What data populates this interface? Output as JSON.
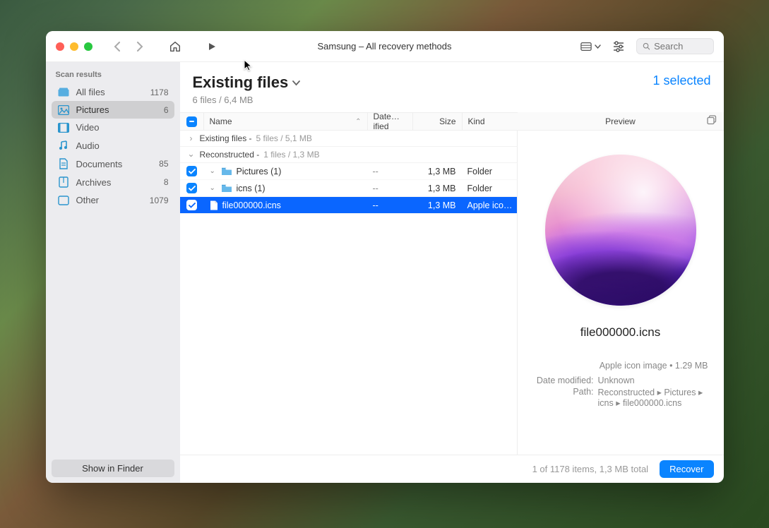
{
  "window_title": "Samsung  – All recovery methods",
  "search": {
    "placeholder": "Search"
  },
  "sidebar": {
    "header": "Scan results",
    "items": [
      {
        "label": "All files",
        "count": "1178"
      },
      {
        "label": "Pictures",
        "count": "6"
      },
      {
        "label": "Video",
        "count": ""
      },
      {
        "label": "Audio",
        "count": ""
      },
      {
        "label": "Documents",
        "count": "85"
      },
      {
        "label": "Archives",
        "count": "8"
      },
      {
        "label": "Other",
        "count": "1079"
      }
    ],
    "show_in_finder": "Show in Finder"
  },
  "content": {
    "title": "Existing files",
    "subtitle": "6 files / 6,4 MB",
    "selected_text": "1 selected",
    "columns": {
      "name": "Name",
      "date": "Date…ified",
      "size": "Size",
      "kind": "Kind"
    },
    "preview_label": "Preview",
    "groups": [
      {
        "label": "Existing files - ",
        "info": "5 files / 5,1 MB",
        "expanded": false
      },
      {
        "label": "Reconstructed - ",
        "info": "1 files / 1,3 MB",
        "expanded": true
      }
    ],
    "rows": [
      {
        "name": "Pictures (1)",
        "date": "--",
        "size": "1,3 MB",
        "kind": "Folder",
        "indent": 1,
        "type": "folder",
        "selected": false
      },
      {
        "name": "icns (1)",
        "date": "--",
        "size": "1,3 MB",
        "kind": "Folder",
        "indent": 2,
        "type": "folder",
        "selected": false
      },
      {
        "name": "file000000.icns",
        "date": "--",
        "size": "1,3 MB",
        "kind": "Apple ico…",
        "indent": 3,
        "type": "file",
        "selected": true
      }
    ]
  },
  "preview": {
    "filename": "file000000.icns",
    "kind_size": "Apple icon image • 1.29 MB",
    "date_modified_label": "Date modified:",
    "date_modified_value": "Unknown",
    "path_label": "Path:",
    "path_value": "Reconstructed ▸ Pictures ▸ icns ▸ file000000.icns"
  },
  "status": {
    "summary": "1 of 1178 items, 1,3 MB total",
    "recover": "Recover"
  }
}
